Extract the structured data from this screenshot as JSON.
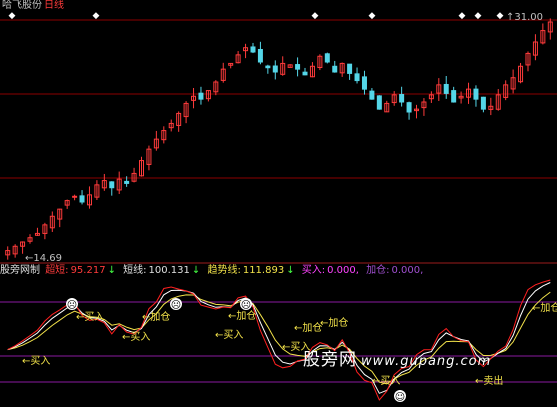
{
  "chart_title": "哈飞股份",
  "period": "日线",
  "price_high_label": "31.00",
  "price_low_label": "14.69",
  "indicator": {
    "name": "股旁网制",
    "items": [
      {
        "label": "超短:",
        "value": "95.217",
        "arrow": "↓",
        "color": "red"
      },
      {
        "label": "短线:",
        "value": "100.131",
        "arrow": "↓",
        "color": "white"
      },
      {
        "label": "趋势线:",
        "value": "111.893",
        "arrow": "↓",
        "color": "yellow"
      },
      {
        "label": "买入:",
        "value": "0.000,",
        "arrow": "",
        "color": "magenta"
      },
      {
        "label": "加仓:",
        "value": "0.000,",
        "arrow": "",
        "color": "purple"
      }
    ]
  },
  "signal_labels": [
    "买入",
    "加仓",
    "卖出"
  ],
  "watermark": {
    "text": "股旁网",
    "url": "www.gupang.com"
  },
  "colors": {
    "background": "#000000",
    "candle_up": "#ff3b3b",
    "candle_down": "#54d6e8",
    "ref_line": "#8b0000",
    "trend_line": "#f2e24a",
    "short_line": "#ffffff",
    "ultra_short_line": "#ff2020",
    "separator": "#9b1b1b",
    "level_line": "#8a1aa0"
  },
  "chart_data": {
    "type": "candlestick",
    "price_range": [
      14.69,
      31.0
    ],
    "close_series": [
      15.0,
      15.3,
      15.6,
      15.9,
      16.2,
      16.8,
      17.4,
      17.9,
      18.5,
      18.8,
      18.4,
      18.9,
      19.6,
      19.9,
      19.4,
      20.0,
      19.7,
      20.4,
      21.3,
      22.1,
      22.8,
      23.4,
      23.9,
      24.6,
      25.3,
      25.8,
      25.6,
      26.2,
      26.8,
      27.7,
      28.1,
      28.7,
      29.2,
      28.9,
      28.2,
      27.8,
      27.5,
      28.1,
      28.0,
      27.7,
      27.3,
      27.9,
      28.6,
      28.2,
      27.5,
      28.1,
      27.4,
      26.9,
      26.3,
      25.6,
      24.9,
      25.3,
      25.9,
      25.4,
      24.7,
      24.9,
      25.4,
      25.9,
      26.6,
      26.0,
      25.4,
      25.8,
      26.3,
      25.6,
      24.9,
      25.1,
      25.9,
      26.6,
      27.1,
      27.9,
      28.8,
      29.6,
      30.4,
      31.0
    ]
  }
}
